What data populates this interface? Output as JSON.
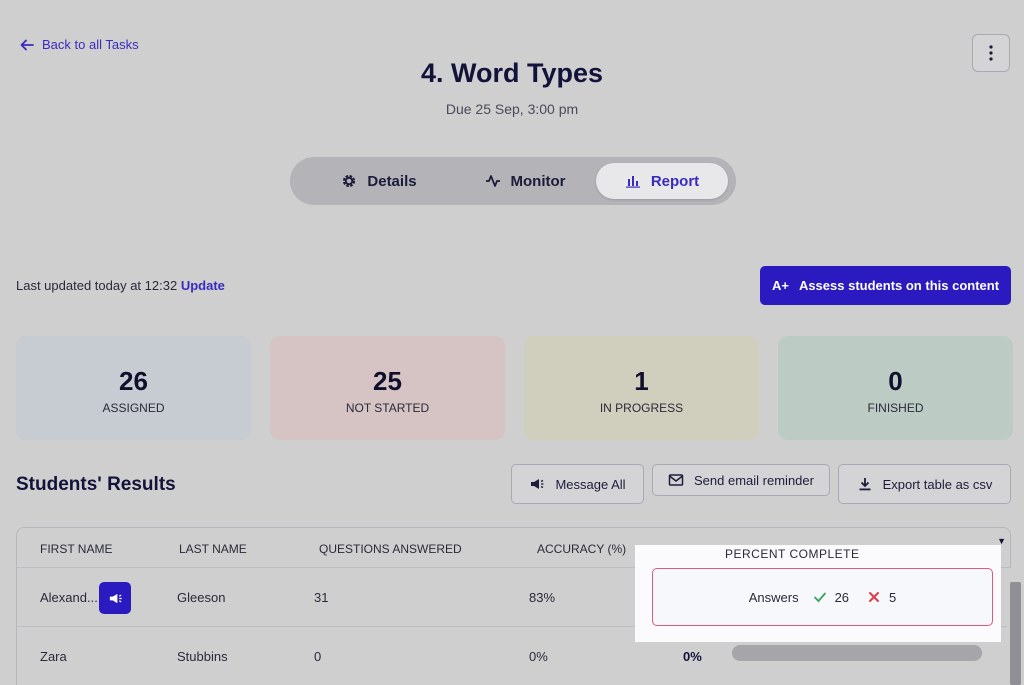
{
  "nav": {
    "back_label": "Back to all Tasks"
  },
  "task": {
    "title": "4. Word Types",
    "due": "Due 25 Sep, 3:00 pm"
  },
  "tabs": [
    {
      "label": "Details",
      "icon": "gear-icon"
    },
    {
      "label": "Monitor",
      "icon": "activity-icon"
    },
    {
      "label": "Report",
      "icon": "bar-chart-icon",
      "active": true
    }
  ],
  "status": {
    "text": "Last updated today at 12:32",
    "update_label": "Update"
  },
  "assess_button": {
    "icon_text": "A+",
    "label": "Assess students on this content"
  },
  "stats": [
    {
      "value": "26",
      "label": "ASSIGNED"
    },
    {
      "value": "25",
      "label": "NOT STARTED"
    },
    {
      "value": "1",
      "label": "IN PROGRESS"
    },
    {
      "value": "0",
      "label": "FINISHED"
    }
  ],
  "results": {
    "title": "Students' Results",
    "message_all_label": "Message All",
    "email_reminder_label": "Send email reminder",
    "export_label": "Export table as csv"
  },
  "table": {
    "columns": [
      "FIRST NAME",
      "LAST NAME",
      "QUESTIONS ANSWERED",
      "ACCURACY (%)",
      "PERCENT COMPLETE"
    ],
    "rows": [
      {
        "first": "Alexand...",
        "last": "Gleeson",
        "answered": "31",
        "accuracy": "83%",
        "percent": "",
        "progress": 0
      },
      {
        "first": "Zara",
        "last": "Stubbins",
        "answered": "0",
        "accuracy": "0%",
        "percent": "0%",
        "progress": 0
      }
    ]
  },
  "tooltip": {
    "label": "Answers",
    "correct": "26",
    "incorrect": "5"
  },
  "colors": {
    "accent": "#2a1ac0",
    "correct": "#3aa35a",
    "incorrect": "#e03c4a",
    "highlight_border": "#e05a7d"
  }
}
